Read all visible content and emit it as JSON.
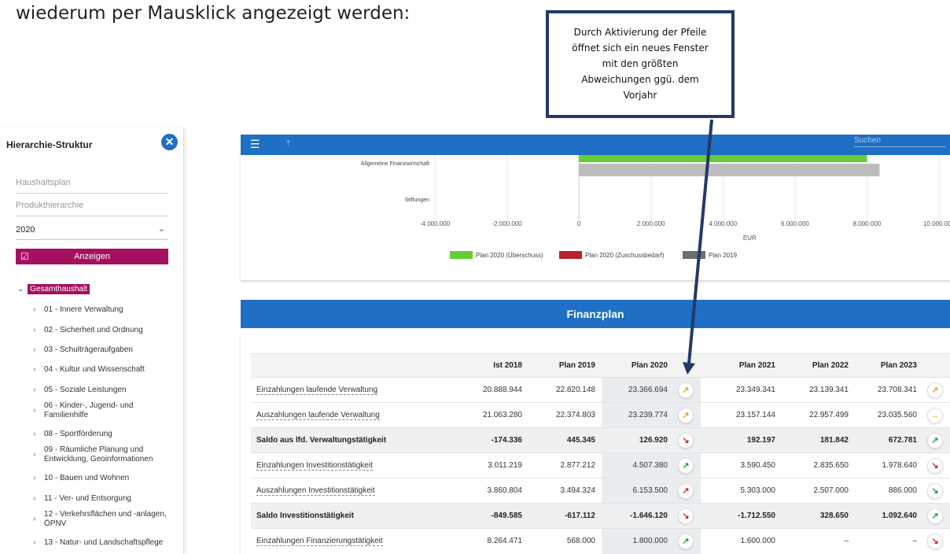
{
  "doc": {
    "intro_text": "wiederum per Mausklick angezeigt werden:",
    "callout_text": "Durch Aktivierung der Pfeile öffnet sich ein neues Fenster mit den größten Abweichungen ggü. dem Vorjahr"
  },
  "sidebar": {
    "title": "Hierarchie-Struktur",
    "haushaltsplan_placeholder": "Haushaltsplan",
    "produkthierarchie_placeholder": "Produkthierarchie",
    "year_value": "2020",
    "show_button": "Anzeigen",
    "tree_root": "Gesamthaushalt",
    "tree_items": [
      "01 - Innere Verwaltung",
      "02 - Sicherheit und Ordnung",
      "03 - Schulträgeraufgaben",
      "04 - Kultur und Wissenschaft",
      "05 - Soziale Leistungen",
      "06 - Kinder-, Jugend- und Familienhilfe",
      "08 - Sportförderung",
      "09 - Räumliche Planung und Entwicklung, Geoinformationen",
      "10 - Bauen und Wohnen",
      "11 - Ver- und Entsorgung",
      "12 - Verkehrsflächen und -anlagen, ÖPNV",
      "13 - Natur- und Landschaftspflege"
    ]
  },
  "topbar": {
    "search_placeholder": "Suchen"
  },
  "chart_data": {
    "type": "bar",
    "orientation": "horizontal",
    "categories": [
      "Allgemeine Finanzwirtschaft",
      "Stiftungen"
    ],
    "series": [
      {
        "name": "Plan 2020 (Überschuss)",
        "color": "#66cc33",
        "values": [
          8000000,
          0
        ]
      },
      {
        "name": "Plan 2020 (Zuschussbedarf)",
        "color": "#b8222a",
        "values": [
          0,
          0
        ]
      },
      {
        "name": "Plan 2019",
        "color": "#bdbdbd",
        "values": [
          8350000,
          0
        ]
      }
    ],
    "xlabel": "EUR",
    "xlim": [
      -4000000,
      10000000
    ],
    "ticks": [
      "-4.000.000",
      "-2.000.000",
      "0",
      "2.000.000",
      "4.000.000",
      "6.000.000",
      "8.000.000",
      "10.000.000"
    ],
    "legend_position": "bottom"
  },
  "finanzplan": {
    "title": "Finanzplan",
    "headers": [
      "",
      "Ist 2018",
      "Plan 2019",
      "Plan 2020",
      "",
      "Plan 2021",
      "Plan 2022",
      "Plan 2023",
      ""
    ],
    "rows": [
      {
        "label": "Einzahlungen laufende Verwaltung",
        "cells": [
          "20.888.944",
          "22.820.148",
          "23.366.694",
          "23.349.341",
          "23.139.341",
          "23.708.341"
        ],
        "arrow1": "↗",
        "arrow1_color": "orange",
        "arrow2": "↗",
        "arrow2_color": "orange",
        "bold": false
      },
      {
        "label": "Auszahlungen laufende Verwaltung",
        "cells": [
          "21.063.280",
          "22.374.803",
          "23.239.774",
          "23.157.144",
          "22.957.499",
          "23.035.560"
        ],
        "arrow1": "↗",
        "arrow1_color": "orange",
        "arrow2": "→",
        "arrow2_color": "orange",
        "bold": false
      },
      {
        "label": "Saldo aus lfd. Verwaltungstätigkeit",
        "cells": [
          "-174.336",
          "445.345",
          "126.920",
          "192.197",
          "181.842",
          "672.781"
        ],
        "arrow1": "↘",
        "arrow1_color": "red",
        "arrow2": "↗",
        "arrow2_color": "green",
        "bold": true
      },
      {
        "label": "Einzahlungen Investitionstätigkeit",
        "cells": [
          "3.011.219",
          "2.877.212",
          "4.507.380",
          "3.590.450",
          "2.835.650",
          "1.978.640"
        ],
        "arrow1": "↗",
        "arrow1_color": "green",
        "arrow2": "↘",
        "arrow2_color": "red",
        "bold": false
      },
      {
        "label": "Auszahlungen Investitionstätigkeit",
        "cells": [
          "3.860.804",
          "3.494.324",
          "6.153.500",
          "5.303.000",
          "2.507.000",
          "886.000"
        ],
        "arrow1": "↗",
        "arrow1_color": "red",
        "arrow2": "↘",
        "arrow2_color": "green",
        "bold": false
      },
      {
        "label": "Saldo Investitionstätigkeit",
        "cells": [
          "-849.585",
          "-617.112",
          "-1.646.120",
          "-1.712.550",
          "328.650",
          "1.092.640"
        ],
        "arrow1": "↘",
        "arrow1_color": "red",
        "arrow2": "↗",
        "arrow2_color": "green",
        "bold": true
      },
      {
        "label": "Einzahlungen Finanzierungstätigkeit",
        "cells": [
          "8.264.471",
          "568.000",
          "1.800.000",
          "1.600.000",
          "–",
          "–"
        ],
        "arrow1": "↗",
        "arrow1_color": "green",
        "arrow2": "↘",
        "arrow2_color": "red",
        "bold": false
      }
    ]
  }
}
